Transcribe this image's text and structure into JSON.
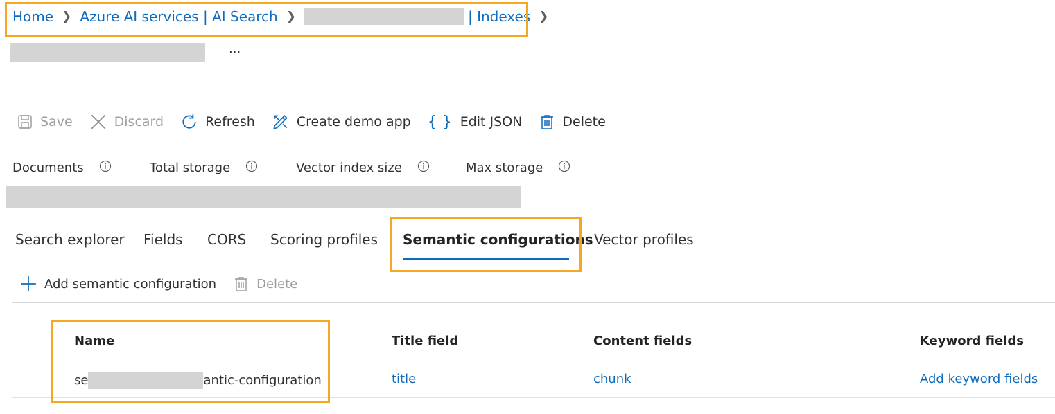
{
  "breadcrumb": {
    "home": "Home",
    "service": "Azure AI services | AI Search",
    "indexes": "| Indexes"
  },
  "header": {
    "more": "..."
  },
  "toolbar": {
    "save": "Save",
    "discard": "Discard",
    "refresh": "Refresh",
    "create_demo_app": "Create demo app",
    "edit_json": "Edit JSON",
    "delete": "Delete"
  },
  "metrics": {
    "documents": "Documents",
    "total_storage": "Total storage",
    "vector_index_size": "Vector index size",
    "max_storage": "Max storage"
  },
  "tabs": {
    "search_explorer": "Search explorer",
    "fields": "Fields",
    "cors": "CORS",
    "scoring_profiles": "Scoring profiles",
    "semantic_configurations": "Semantic configurations",
    "vector_profiles": "Vector profiles"
  },
  "semantic_toolbar": {
    "add": "Add semantic configuration",
    "delete": "Delete"
  },
  "table": {
    "columns": {
      "name": "Name",
      "title_field": "Title field",
      "content_fields": "Content fields",
      "keyword_fields": "Keyword fields"
    },
    "rows": [
      {
        "name_prefix": "se",
        "name_suffix": "antic-configuration",
        "title_field": "title",
        "content_fields": "chunk",
        "keyword_fields": "Add keyword fields"
      }
    ]
  },
  "colors": {
    "accent": "#0f6cbd",
    "highlight": "#f5a623",
    "redaction": "#d4d4d4",
    "text": "#323130",
    "disabled": "#a19f9d"
  }
}
